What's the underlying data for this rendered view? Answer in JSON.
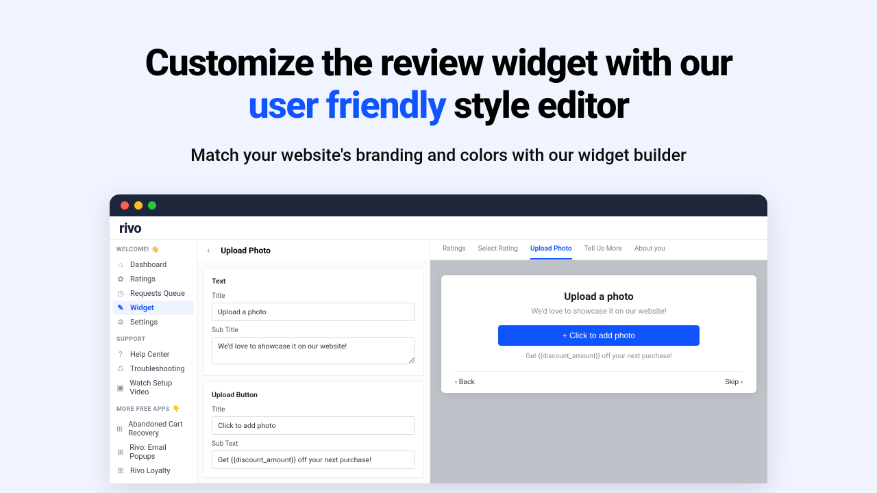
{
  "hero": {
    "title_pre": "Customize the review widget with our ",
    "title_accent": "user friendly",
    "title_post": " style editor",
    "subtitle": "Match your website's branding and colors with our widget builder"
  },
  "logo": "rivo",
  "sidebar": {
    "welcome_label": "WELCOME!",
    "items": [
      {
        "label": "Dashboard",
        "icon": "⌂"
      },
      {
        "label": "Ratings",
        "icon": "✿"
      },
      {
        "label": "Requests Queue",
        "icon": "◷"
      },
      {
        "label": "Widget",
        "icon": "✎"
      },
      {
        "label": "Settings",
        "icon": "⚙"
      }
    ],
    "support_label": "SUPPORT",
    "support": [
      {
        "label": "Help Center",
        "icon": "?"
      },
      {
        "label": "Troubleshooting",
        "icon": "♺"
      },
      {
        "label": "Watch Setup Video",
        "icon": "▣"
      }
    ],
    "apps_label": "MORE FREE APPS",
    "apps": [
      {
        "label": "Abandoned Cart Recovery",
        "icon": "⊞"
      },
      {
        "label": "Rivo: Email Popups",
        "icon": "⊞"
      },
      {
        "label": "Rivo Loyalty",
        "icon": "⊞"
      }
    ]
  },
  "editor": {
    "page_title": "Upload Photo",
    "text_section": "Text",
    "title_label": "Title",
    "title_value": "Upload a photo",
    "subtitle_label": "Sub Title",
    "subtitle_value": "We'd love to showcase it on our website!",
    "button_section": "Upload Button",
    "btn_title_label": "Title",
    "btn_title_value": "Click to add photo",
    "btn_sub_label": "Sub Text",
    "btn_sub_value": "Get {{discount_amount}} off your next purchase!"
  },
  "preview": {
    "tabs": [
      "Ratings",
      "Select Rating",
      "Upload Photo",
      "Tell Us More",
      "About you"
    ],
    "active_tab": 2,
    "modal_title": "Upload a photo",
    "modal_sub": "We'd love to showcase it on our website!",
    "modal_btn": "+ Click to add photo",
    "modal_hint": "Get {{discount_amount}} off your next purchase!",
    "back": "Back",
    "skip": "Skip"
  }
}
